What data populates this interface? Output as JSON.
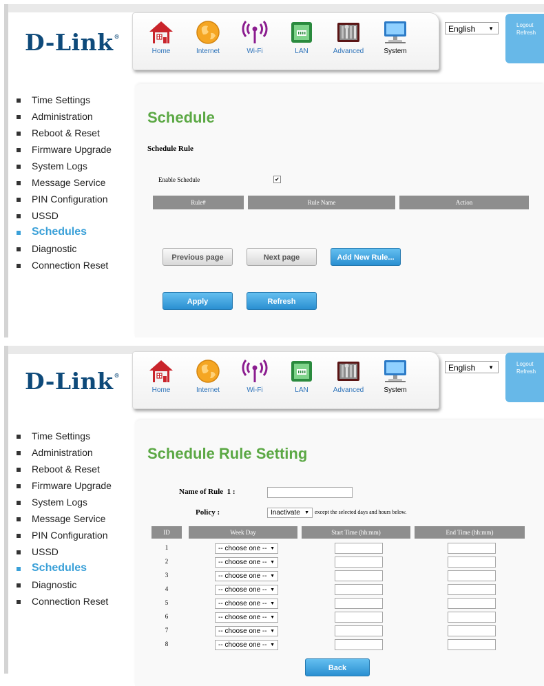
{
  "brand": "D-Link",
  "nav": [
    {
      "label": "Home",
      "icon": "home-icon"
    },
    {
      "label": "Internet",
      "icon": "globe-icon"
    },
    {
      "label": "Wi-Fi",
      "icon": "wifi-icon"
    },
    {
      "label": "LAN",
      "icon": "lan-icon"
    },
    {
      "label": "Advanced",
      "icon": "tools-icon"
    },
    {
      "label": "System",
      "icon": "computer-icon"
    }
  ],
  "language": "English",
  "logout_label": "Logout",
  "refresh_label": "Refresh",
  "sidebar": [
    "Time Settings",
    "Administration",
    "Reboot & Reset",
    "Firmware Upgrade",
    "System Logs",
    "Message Service",
    "PIN Configuration",
    "USSD",
    "Schedules",
    "Diagnostic",
    "Connection Reset"
  ],
  "sidebar_active": "Schedules",
  "schedule": {
    "title": "Schedule",
    "section": "Schedule Rule",
    "enable_label": "Enable Schedule",
    "enable_checked": true,
    "columns": [
      "Rule#",
      "Rule Name",
      "Action"
    ],
    "prev_label": "Previous page",
    "next_label": "Next page",
    "add_label": "Add New Rule...",
    "apply_label": "Apply",
    "refresh_label": "Refresh"
  },
  "rule": {
    "title": "Schedule Rule Setting",
    "name_label": "Name of Rule  1 :",
    "name_value": "",
    "policy_label": "Policy :",
    "policy_value": "Inactivate",
    "policy_note": "except the selected days and hours below.",
    "columns": [
      "ID",
      "Week Day",
      "Start Time (hh:mm)",
      "End Time (hh:mm)"
    ],
    "rows": [
      {
        "id": "1",
        "weekday": "-- choose one --",
        "start": "",
        "end": ""
      },
      {
        "id": "2",
        "weekday": "-- choose one --",
        "start": "",
        "end": ""
      },
      {
        "id": "3",
        "weekday": "-- choose one --",
        "start": "",
        "end": ""
      },
      {
        "id": "4",
        "weekday": "-- choose one --",
        "start": "",
        "end": ""
      },
      {
        "id": "5",
        "weekday": "-- choose one --",
        "start": "",
        "end": ""
      },
      {
        "id": "6",
        "weekday": "-- choose one --",
        "start": "",
        "end": ""
      },
      {
        "id": "7",
        "weekday": "-- choose one --",
        "start": "",
        "end": ""
      },
      {
        "id": "8",
        "weekday": "-- choose one --",
        "start": "",
        "end": ""
      }
    ],
    "back_label": "Back"
  },
  "colors": {
    "accent_green": "#5ba844",
    "accent_blue": "#3aa0d8",
    "brand_blue": "#0e4a7a"
  }
}
